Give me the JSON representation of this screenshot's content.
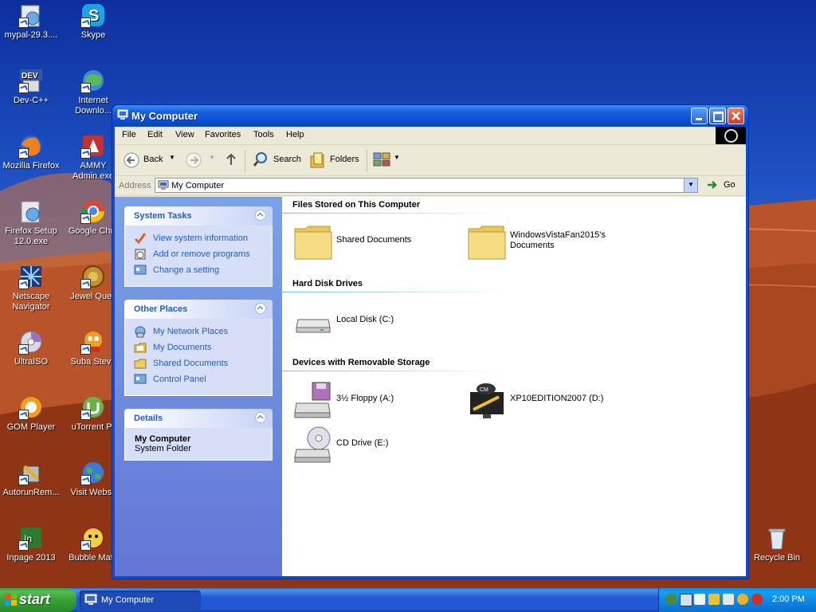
{
  "desktop": {
    "icons": [
      {
        "label": "mypal-29.3...."
      },
      {
        "label": "Skype"
      },
      {
        "label": "Dev-C++"
      },
      {
        "label": "Internet\nDownlo..."
      },
      {
        "label": "Mozilla Firefox"
      },
      {
        "label": "AMMY\nAdmin.exe"
      },
      {
        "label": "Firefox Setup\n12.0.exe"
      },
      {
        "label": "Google Chro"
      },
      {
        "label": "Netscape\nNavigator"
      },
      {
        "label": "Jewel Ques"
      },
      {
        "label": "UltraISO"
      },
      {
        "label": "Suba Steve"
      },
      {
        "label": "GOM Player"
      },
      {
        "label": "uTorrent Pr"
      },
      {
        "label": "AutorunRem..."
      },
      {
        "label": "Visit Websit"
      },
      {
        "label": "Inpage 2013"
      },
      {
        "label": "Bubble Mate"
      },
      {
        "label": "Recycle Bin"
      }
    ]
  },
  "window": {
    "title": "My Computer",
    "menu": [
      "File",
      "Edit",
      "View",
      "Favorites",
      "Tools",
      "Help"
    ],
    "toolbar": {
      "back": "Back",
      "search": "Search",
      "folders": "Folders"
    },
    "address": {
      "label": "Address",
      "value": "My Computer",
      "go": "Go"
    }
  },
  "left_pane": {
    "system_tasks": {
      "title": "System Tasks",
      "links": [
        "View system information",
        "Add or remove programs",
        "Change a setting"
      ]
    },
    "other_places": {
      "title": "Other Places",
      "links": [
        "My Network Places",
        "My Documents",
        "Shared Documents",
        "Control Panel"
      ]
    },
    "details": {
      "title": "Details",
      "name": "My Computer",
      "type": "System Folder"
    }
  },
  "right_pane": {
    "files_section": "Files Stored on This Computer",
    "files": [
      "Shared Documents",
      "WindowsVistaFan2015's\nDocuments"
    ],
    "hdd_section": "Hard Disk Drives",
    "hdds": [
      "Local Disk (C:)"
    ],
    "removable_section": "Devices with Removable Storage",
    "removable": [
      "3½ Floppy (A:)",
      "XP10EDITION2007 (D:)",
      "CD Drive (E:)"
    ]
  },
  "taskbar": {
    "start": "start",
    "task": "My Computer",
    "clock": "2:00 PM"
  },
  "colors": {
    "accent": "#0a4fd6",
    "link": "#215dc6",
    "start_green": "#36a036"
  }
}
